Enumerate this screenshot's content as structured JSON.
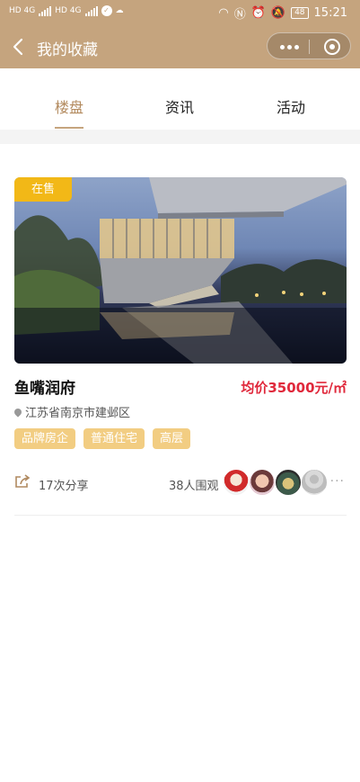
{
  "status_bar": {
    "network_left": "HD 4G",
    "network_right": "HD 4G",
    "battery": "48",
    "time": "15:21"
  },
  "nav": {
    "title": "我的收藏"
  },
  "tabs": [
    {
      "label": "楼盘",
      "active": true
    },
    {
      "label": "资讯",
      "active": false
    },
    {
      "label": "活动",
      "active": false
    }
  ],
  "property": {
    "badge": "在售",
    "name": "鱼嘴润府",
    "price": "均价35000元/㎡",
    "address": "江苏省南京市建邺区",
    "tags": [
      "品牌房企",
      "普通住宅",
      "高层"
    ],
    "shares": "17次分享",
    "viewers": "38人围观"
  },
  "icons": {
    "back": "chevron-left-icon",
    "menu": "more-dots-icon",
    "close": "target-circle-icon",
    "share": "share-icon",
    "location": "location-pin-icon"
  },
  "colors": {
    "brand": "#c5a47e",
    "active_tab": "#b38a5e",
    "sale_badge": "#f2b817",
    "tag_bg": "#f2cd82",
    "price": "#e0283b"
  }
}
